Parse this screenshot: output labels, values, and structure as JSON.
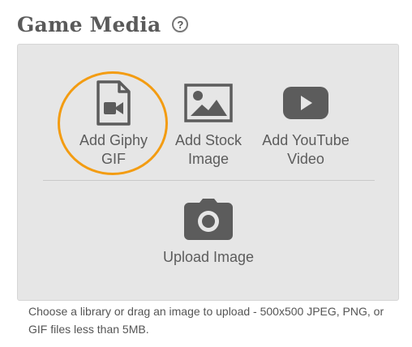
{
  "header": {
    "title": "Game Media",
    "help_label": "?"
  },
  "media_options": [
    {
      "label_line1": "Add Giphy",
      "label_line2": "GIF",
      "icon": "video-file-icon",
      "highlighted": true
    },
    {
      "label_line1": "Add Stock",
      "label_line2": "Image",
      "icon": "image-icon"
    },
    {
      "label_line1": "Add YouTube",
      "label_line2": "Video",
      "icon": "youtube-play-icon"
    }
  ],
  "upload": {
    "label": "Upload Image",
    "icon": "camera-icon"
  },
  "hint": "Choose a library or drag an image to upload - 500x500 JPEG, PNG, or GIF files less than 5MB.",
  "colors": {
    "icon": "#5c5c5c",
    "highlight": "#f39c12",
    "panel": "#e6e6e6"
  }
}
